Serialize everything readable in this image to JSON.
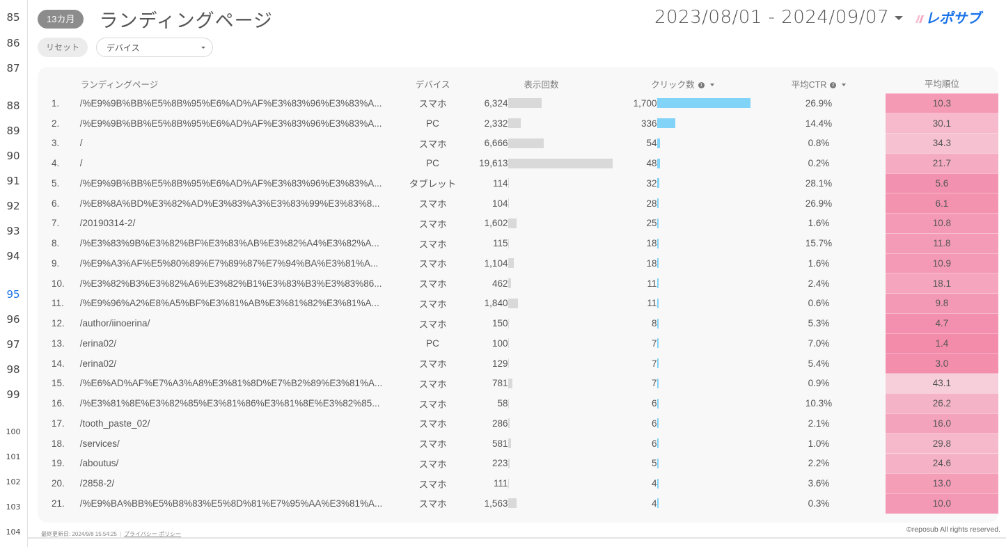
{
  "gutter": {
    "lines": [
      "85",
      "86",
      "87",
      "88",
      "89",
      "90",
      "91",
      "92",
      "93",
      "94",
      "95",
      "96",
      "97",
      "98",
      "99",
      "100",
      "101",
      "102",
      "103",
      "104"
    ],
    "active": "95"
  },
  "header": {
    "period_chip": "13カ月",
    "title": "ランディングページ",
    "date_range": "2023/08/01 - 2024/09/07",
    "logo_text": "レポサブ"
  },
  "filters": {
    "reset_label": "リセット",
    "device_label": "デバイス"
  },
  "table": {
    "columns": {
      "page": "ランディングページ",
      "device": "デバイス",
      "impressions": "表示回数",
      "clicks": "クリック数",
      "clicks_sort_order": "1",
      "ctr": "平均CTR",
      "ctr_sort_order": "2",
      "rank": "平均順位"
    },
    "max_impressions": 19613,
    "max_clicks": 1700,
    "rows": [
      {
        "n": "1.",
        "page": "/%E9%9B%BB%E5%8B%95%E6%AD%AF%E3%83%96%E3%83%A...",
        "device": "スマホ",
        "impressions": "6,324",
        "imp_value": 6324,
        "clicks": "1,700",
        "clk_value": 1700,
        "ctr": "26.9%",
        "rank": "10.3"
      },
      {
        "n": "2.",
        "page": "/%E9%9B%BB%E5%8B%95%E6%AD%AF%E3%83%96%E3%83%A...",
        "device": "PC",
        "impressions": "2,332",
        "imp_value": 2332,
        "clicks": "336",
        "clk_value": 336,
        "ctr": "14.4%",
        "rank": "30.1"
      },
      {
        "n": "3.",
        "page": "/",
        "device": "スマホ",
        "impressions": "6,666",
        "imp_value": 6666,
        "clicks": "54",
        "clk_value": 54,
        "ctr": "0.8%",
        "rank": "34.3"
      },
      {
        "n": "4.",
        "page": "/",
        "device": "PC",
        "impressions": "19,613",
        "imp_value": 19613,
        "clicks": "48",
        "clk_value": 48,
        "ctr": "0.2%",
        "rank": "21.7"
      },
      {
        "n": "5.",
        "page": "/%E9%9B%BB%E5%8B%95%E6%AD%AF%E3%83%96%E3%83%A...",
        "device": "タブレット",
        "impressions": "114",
        "imp_value": 114,
        "clicks": "32",
        "clk_value": 32,
        "ctr": "28.1%",
        "rank": "5.6"
      },
      {
        "n": "6.",
        "page": "/%E8%8A%BD%E3%82%AD%E3%83%A3%E3%83%99%E3%83%8...",
        "device": "スマホ",
        "impressions": "104",
        "imp_value": 104,
        "clicks": "28",
        "clk_value": 28,
        "ctr": "26.9%",
        "rank": "6.1"
      },
      {
        "n": "7.",
        "page": "/20190314-2/",
        "device": "スマホ",
        "impressions": "1,602",
        "imp_value": 1602,
        "clicks": "25",
        "clk_value": 25,
        "ctr": "1.6%",
        "rank": "10.8"
      },
      {
        "n": "8.",
        "page": "/%E3%83%9B%E3%82%BF%E3%83%AB%E3%82%A4%E3%82%A...",
        "device": "スマホ",
        "impressions": "115",
        "imp_value": 115,
        "clicks": "18",
        "clk_value": 18,
        "ctr": "15.7%",
        "rank": "11.8"
      },
      {
        "n": "9.",
        "page": "/%E9%A3%AF%E5%80%89%E7%89%87%E7%94%BA%E3%81%A...",
        "device": "スマホ",
        "impressions": "1,104",
        "imp_value": 1104,
        "clicks": "18",
        "clk_value": 18,
        "ctr": "1.6%",
        "rank": "10.9"
      },
      {
        "n": "10.",
        "page": "/%E3%82%B3%E3%82%A6%E3%82%B1%E3%83%B3%E3%83%86...",
        "device": "スマホ",
        "impressions": "462",
        "imp_value": 462,
        "clicks": "11",
        "clk_value": 11,
        "ctr": "2.4%",
        "rank": "18.1"
      },
      {
        "n": "11.",
        "page": "/%E9%96%A2%E8%A5%BF%E3%81%AB%E3%81%82%E3%81%A...",
        "device": "スマホ",
        "impressions": "1,840",
        "imp_value": 1840,
        "clicks": "11",
        "clk_value": 11,
        "ctr": "0.6%",
        "rank": "9.8"
      },
      {
        "n": "12.",
        "page": "/author/iinoerina/",
        "device": "スマホ",
        "impressions": "150",
        "imp_value": 150,
        "clicks": "8",
        "clk_value": 8,
        "ctr": "5.3%",
        "rank": "4.7"
      },
      {
        "n": "13.",
        "page": "/erina02/",
        "device": "PC",
        "impressions": "100",
        "imp_value": 100,
        "clicks": "7",
        "clk_value": 7,
        "ctr": "7.0%",
        "rank": "1.4"
      },
      {
        "n": "14.",
        "page": "/erina02/",
        "device": "スマホ",
        "impressions": "129",
        "imp_value": 129,
        "clicks": "7",
        "clk_value": 7,
        "ctr": "5.4%",
        "rank": "3.0"
      },
      {
        "n": "15.",
        "page": "/%E6%AD%AF%E7%A3%A8%E3%81%8D%E7%B2%89%E3%81%A...",
        "device": "スマホ",
        "impressions": "781",
        "imp_value": 781,
        "clicks": "7",
        "clk_value": 7,
        "ctr": "0.9%",
        "rank": "43.1"
      },
      {
        "n": "16.",
        "page": "/%E3%81%8E%E3%82%85%E3%81%86%E3%81%8E%E3%82%85...",
        "device": "スマホ",
        "impressions": "58",
        "imp_value": 58,
        "clicks": "6",
        "clk_value": 6,
        "ctr": "10.3%",
        "rank": "26.2"
      },
      {
        "n": "17.",
        "page": "/tooth_paste_02/",
        "device": "スマホ",
        "impressions": "286",
        "imp_value": 286,
        "clicks": "6",
        "clk_value": 6,
        "ctr": "2.1%",
        "rank": "16.0"
      },
      {
        "n": "18.",
        "page": "/services/",
        "device": "スマホ",
        "impressions": "581",
        "imp_value": 581,
        "clicks": "6",
        "clk_value": 6,
        "ctr": "1.0%",
        "rank": "29.8"
      },
      {
        "n": "19.",
        "page": "/aboutus/",
        "device": "スマホ",
        "impressions": "223",
        "imp_value": 223,
        "clicks": "5",
        "clk_value": 5,
        "ctr": "2.2%",
        "rank": "24.6"
      },
      {
        "n": "20.",
        "page": "/2858-2/",
        "device": "スマホ",
        "impressions": "111",
        "imp_value": 111,
        "clicks": "4",
        "clk_value": 4,
        "ctr": "3.6%",
        "rank": "13.0"
      },
      {
        "n": "21.",
        "page": "/%E9%BA%BB%E5%B8%83%E5%8D%81%E7%95%AA%E3%81%A...",
        "device": "スマホ",
        "impressions": "1,563",
        "imp_value": 1563,
        "clicks": "4",
        "clk_value": 4,
        "ctr": "0.3%",
        "rank": "10.0"
      }
    ]
  },
  "colors": {
    "click_bar": "#82d3f8",
    "impression_bar": "#d9d9d9",
    "rank_heat_strong": "#f38bab",
    "rank_heat_weak": "#f7cfdb",
    "logo_blue": "#1a73e8",
    "logo_pink": "#f5a7c0"
  },
  "footer": {
    "last_updated": "最終更新日: 2024/9/8 15:54:25",
    "privacy_link": "プライバシー ポリシー",
    "copyright": "©reposub All rights reserved."
  }
}
